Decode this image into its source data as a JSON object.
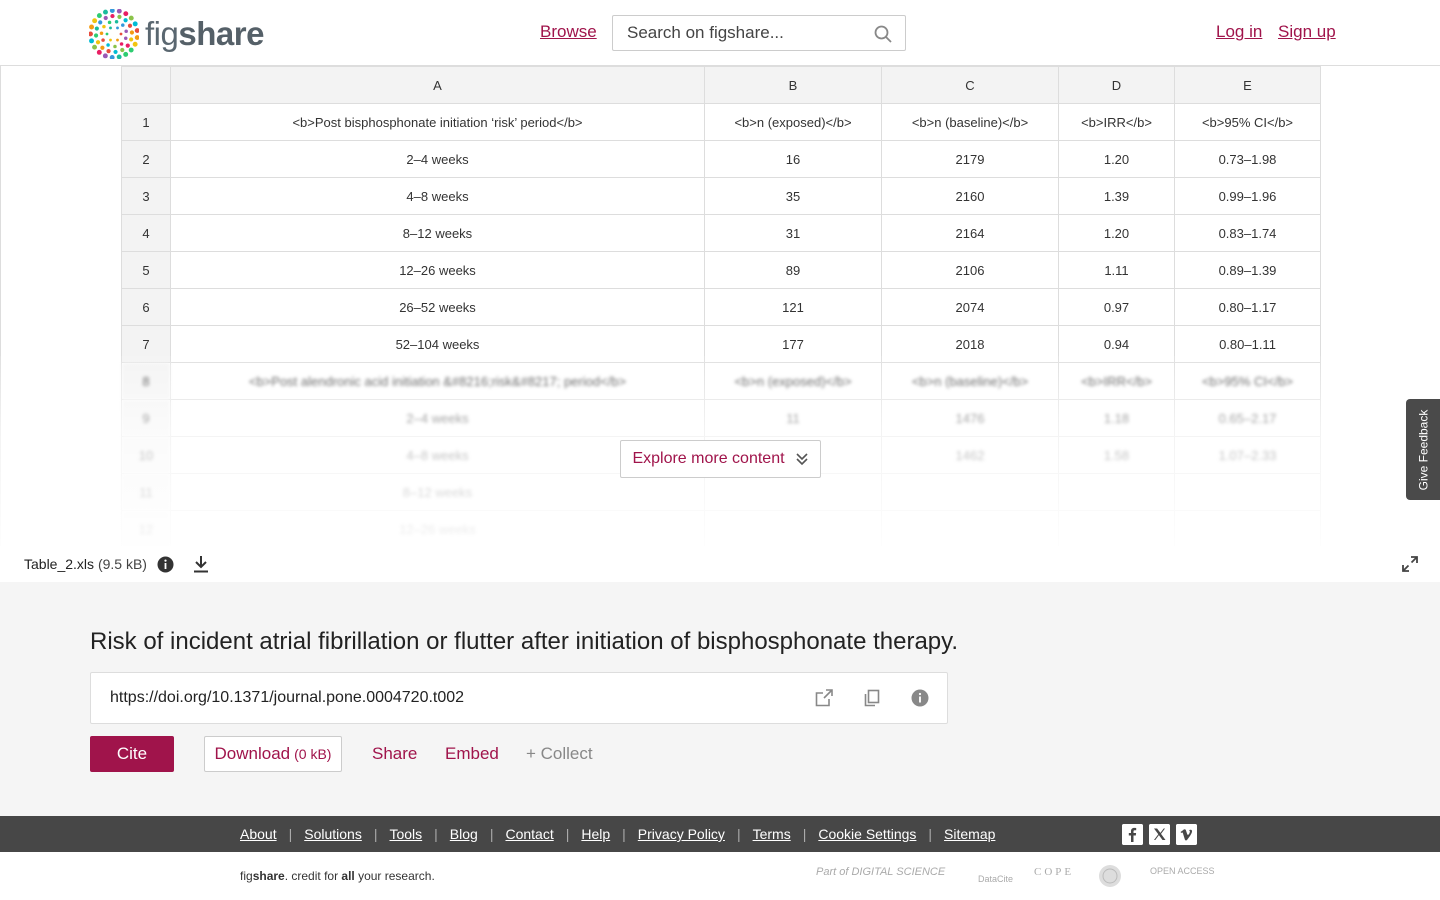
{
  "header": {
    "logo_text_light": "fig",
    "logo_text_bold": "share",
    "browse_label": "Browse",
    "search_placeholder": "Search on figshare...",
    "login_label": "Log in",
    "signup_label": "Sign up"
  },
  "sheet": {
    "columns": [
      "",
      "A",
      "B",
      "C",
      "D",
      "E"
    ],
    "rows": [
      [
        "1",
        "<b>Post bisphosphonate initiation ‘risk’ period</b>",
        "<b>n (exposed)</b>",
        "<b>n (baseline)</b>",
        "<b>IRR</b>",
        "<b>95% CI</b>"
      ],
      [
        "2",
        "2–4 weeks",
        "16",
        "2179",
        "1.20",
        "0.73–1.98"
      ],
      [
        "3",
        "4–8 weeks",
        "35",
        "2160",
        "1.39",
        "0.99–1.96"
      ],
      [
        "4",
        "8–12 weeks",
        "31",
        "2164",
        "1.20",
        "0.83–1.74"
      ],
      [
        "5",
        "12–26 weeks",
        "89",
        "2106",
        "1.11",
        "0.89–1.39"
      ],
      [
        "6",
        "26–52 weeks",
        "121",
        "2074",
        "0.97",
        "0.80–1.17"
      ],
      [
        "7",
        "52–104 weeks",
        "177",
        "2018",
        "0.94",
        "0.80–1.11"
      ],
      [
        "8",
        "<b>Post alendronic acid initiation &#8216;risk&#8217; period</b>",
        "<b>n (exposed)</b>",
        "<b>n (baseline)</b>",
        "<b>IRR</b>",
        "<b>95% CI</b>"
      ],
      [
        "9",
        "2–4 weeks",
        "11",
        "1476",
        "1.18",
        "0.65–2.17"
      ],
      [
        "10",
        "4–8 weeks",
        "",
        "1462",
        "1.58",
        "1.07–2.33"
      ],
      [
        "11",
        "8–12 weeks",
        "",
        "",
        "",
        ""
      ],
      [
        "12",
        "12–26 weeks",
        "",
        "",
        "",
        ""
      ]
    ]
  },
  "explore_label": "Explore more content",
  "feedback_label": "Give Feedback",
  "file": {
    "name": "Table_2.xls",
    "size": "(9.5 kB)"
  },
  "meta": {
    "title": "Risk of incident atrial fibrillation or flutter after initiation of bisphosphonate therapy.",
    "doi": "https://doi.org/10.1371/journal.pone.0004720.t002",
    "cite_label": "Cite",
    "download_label": "Download",
    "download_size": "(0 kB)",
    "share_label": "Share",
    "embed_label": "Embed",
    "collect_label": "+ Collect"
  },
  "footer": {
    "links": [
      "About",
      "Solutions",
      "Tools",
      "Blog",
      "Contact",
      "Help",
      "Privacy Policy",
      "Terms",
      "Cookie Settings",
      "Sitemap"
    ],
    "tagline_pre": "fig",
    "tagline_bold": "share",
    "tagline_mid": ". credit for ",
    "tagline_all": "all",
    "tagline_post": " your research.",
    "partners": [
      "Part of DIGITAL SCIENCE",
      "DataCite",
      "COPE",
      "OPEN ACCESS"
    ]
  },
  "colors": {
    "brand": "#a0144b",
    "footer_bg": "#474747",
    "meta_bg": "#f5f5f5"
  }
}
